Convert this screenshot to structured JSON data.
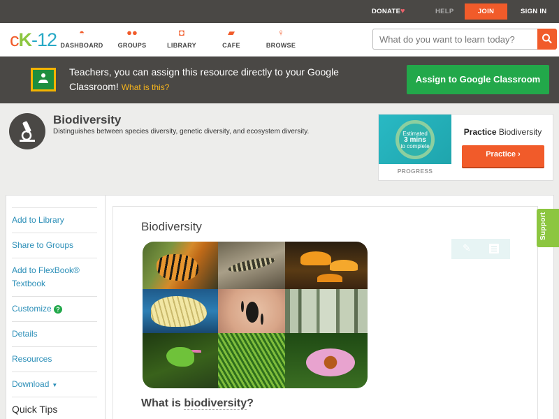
{
  "topbar": {
    "donate": "DONATE",
    "help": "HELP",
    "join": "JOIN",
    "signin": "SIGN IN"
  },
  "logo": {
    "c": "c",
    "k": "K",
    "n": "-12"
  },
  "nav": {
    "dashboard": "DASHBOARD",
    "groups": "GROUPS",
    "library": "LIBRARY",
    "cafe": "CAFE",
    "browse": "BROWSE"
  },
  "search": {
    "placeholder": "What do you want to learn today?"
  },
  "banner": {
    "text": "Teachers, you can assign this resource directly to your Google Classroom!",
    "link": "What is this?",
    "button": "Assign to Google Classroom"
  },
  "concept": {
    "title": "Biodiversity",
    "description": "Distinguishes between species diversity, genetic diversity, and ecosystem diversity."
  },
  "practice": {
    "estimated": "Estimated",
    "minutes": "3 mins",
    "to_complete": "to complete",
    "progress_label": "PROGRESS",
    "title_bold": "Practice",
    "title_rest": "Biodiversity",
    "button": "Practice"
  },
  "sidebar": {
    "items": [
      {
        "label": "Add to Library"
      },
      {
        "label": "Share to Groups"
      },
      {
        "label": "Add to FlexBook® Textbook"
      },
      {
        "label": "Customize"
      },
      {
        "label": "Details"
      },
      {
        "label": "Resources"
      },
      {
        "label": "Download"
      }
    ],
    "help_glyph": "?",
    "quick_tips": "Quick Tips"
  },
  "content": {
    "title": "Biodiversity",
    "heading_prefix": "What is ",
    "heading_term": "biodiversity",
    "heading_suffix": "?"
  },
  "support": {
    "label": "Support"
  },
  "colors": {
    "brand_orange": "#f15b2a",
    "brand_green": "#8cc640",
    "brand_blue": "#27a9c6",
    "dark_bar": "#4a4845",
    "classroom_green": "#22a84a",
    "link_blue": "#2c8fb8"
  }
}
